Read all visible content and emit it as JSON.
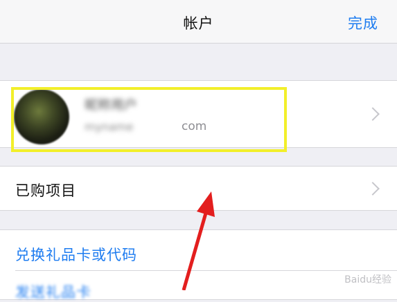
{
  "navbar": {
    "title": "帐户",
    "done_label": "完成"
  },
  "account": {
    "name_blurred": "昵称用户",
    "email_blurred": "myname",
    "email_visible": "com"
  },
  "purchased": {
    "label": "已购项目"
  },
  "links": [
    {
      "label": "兑换礼品卡或代码"
    },
    {
      "label": "发送礼品卡"
    }
  ],
  "colors": {
    "accent_blue": "#1e7cf0",
    "highlight_yellow": "#f2ef2a",
    "annotation_red": "#e31e1e"
  },
  "watermark": {
    "text": "Baidu经验"
  }
}
